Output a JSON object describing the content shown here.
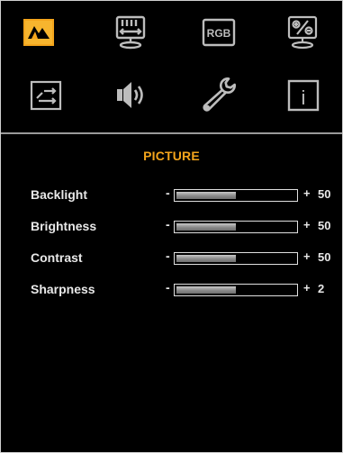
{
  "menu": {
    "icons": [
      {
        "name": "picture-icon",
        "selected": true
      },
      {
        "name": "display-position-icon",
        "selected": false
      },
      {
        "name": "rgb-icon",
        "label": "RGB",
        "selected": false
      },
      {
        "name": "display-settings-icon",
        "selected": false
      },
      {
        "name": "input-source-icon",
        "selected": false
      },
      {
        "name": "audio-icon",
        "selected": false
      },
      {
        "name": "tools-icon",
        "selected": false
      },
      {
        "name": "info-icon",
        "label": "i",
        "selected": false
      }
    ]
  },
  "section": {
    "title": "PICTURE"
  },
  "settings": [
    {
      "label": "Backlight",
      "minus": "-",
      "plus": "+",
      "value": "50",
      "level": 0.5
    },
    {
      "label": "Brightness",
      "minus": "-",
      "plus": "+",
      "value": "50",
      "level": 0.5
    },
    {
      "label": "Contrast",
      "minus": "-",
      "plus": "+",
      "value": "50",
      "level": 0.5
    },
    {
      "label": "Sharpness",
      "minus": "-",
      "plus": "+",
      "value": "2",
      "level": 0.5
    }
  ],
  "colors": {
    "accent": "#f4a51c",
    "icon": "#bdbdbd",
    "background": "#000000"
  }
}
